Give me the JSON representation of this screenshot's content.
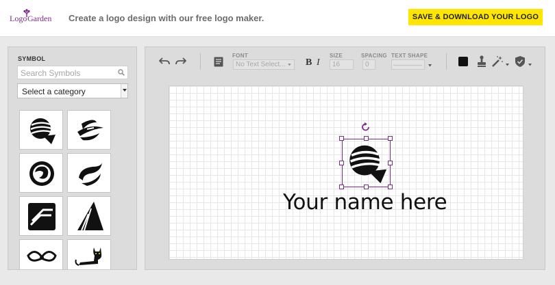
{
  "brand": {
    "part1": "Logo",
    "part2": "Garden",
    "accent": "#7a2a86"
  },
  "header": {
    "tagline": "Create a logo design with our free logo maker.",
    "save_label": "SAVE & DOWNLOAD YOUR LOGO",
    "save_color": "#ffe500"
  },
  "sidebar": {
    "section_label": "SYMBOL",
    "search": {
      "placeholder": "Search Symbols",
      "value": ""
    },
    "category": {
      "selected": "Select a category"
    },
    "symbols": [
      {
        "icon": "swoosh-sphere-icon"
      },
      {
        "icon": "orbit-ring-icon"
      },
      {
        "icon": "spiral-circle-icon"
      },
      {
        "icon": "swirl-orbit-icon"
      },
      {
        "icon": "split-square-icon"
      },
      {
        "icon": "stripe-pyramid-icon"
      },
      {
        "icon": "bow-ribbon-icon"
      },
      {
        "icon": "cat-icon"
      }
    ]
  },
  "toolbar": {
    "font": {
      "label": "FONT",
      "value": "No Text Select..."
    },
    "bold_glyph": "B",
    "italic_glyph": "I",
    "size": {
      "label": "SIZE",
      "value": "16"
    },
    "spacing": {
      "label": "SPACING",
      "value": "0"
    },
    "shape": {
      "label": "TEXT SHAPE"
    },
    "color": "#111111"
  },
  "canvas": {
    "name_text": "Your name here",
    "selected_symbol": "swoosh-sphere-icon"
  }
}
